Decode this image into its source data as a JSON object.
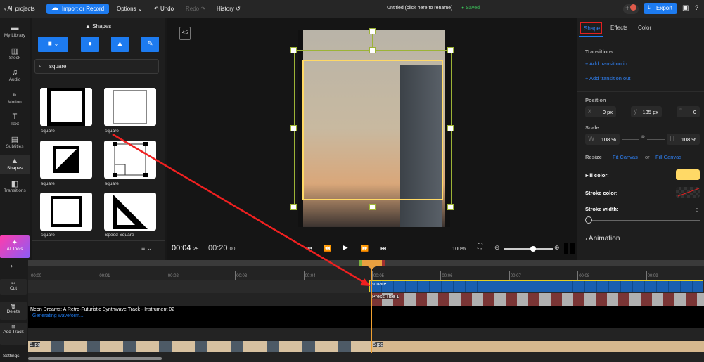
{
  "topbar": {
    "back": "All projects",
    "import": "Import or Record",
    "options": "Options",
    "undo": "Undo",
    "redo": "Redo",
    "history": "History",
    "title": "Untitled (click here to rename)",
    "saved": "Saved",
    "export": "Export"
  },
  "rail": [
    {
      "label": "My Library",
      "icon": "folder"
    },
    {
      "label": "Stock",
      "icon": "books"
    },
    {
      "label": "Audio",
      "icon": "music"
    },
    {
      "label": "Motion",
      "icon": "motion"
    },
    {
      "label": "Text",
      "icon": "T"
    },
    {
      "label": "Subtitles",
      "icon": "cc"
    },
    {
      "label": "Shapes",
      "icon": "shapes"
    },
    {
      "label": "Transitions",
      "icon": "transition"
    }
  ],
  "ai_tools": "AI Tools",
  "panel": {
    "title": "Shapes",
    "search_value": "square",
    "results": [
      {
        "label": "square"
      },
      {
        "label": "square"
      },
      {
        "label": "square"
      },
      {
        "label": "square"
      },
      {
        "label": "square"
      },
      {
        "label": "Speed Square"
      }
    ]
  },
  "preview": {
    "aspect": "4:5",
    "time_current": "00:04",
    "time_current_frames": "29",
    "time_total": "00:20",
    "time_total_frames": "00",
    "zoom": "100%",
    "zoom_slider": 0.6
  },
  "right": {
    "tabs": [
      "Shape",
      "Effects",
      "Color"
    ],
    "active_tab": "Shape",
    "transitions": "Transitions",
    "add_in": "+ Add transition in",
    "add_out": "+ Add transition out",
    "position": "Position",
    "x_label": "x",
    "x": "0 px",
    "y_label": "y",
    "y": "135 px",
    "rot_label": "°",
    "rotation": "0",
    "scale": "Scale",
    "w_label": "W",
    "w": "108 %",
    "h_label": "H",
    "h": "108 %",
    "resize": "Resize",
    "fit": "Fit Canvas",
    "or": "or",
    "fill": "Fill Canvas",
    "fill_color_label": "Fill color:",
    "fill_color": "#ffd966",
    "stroke_color_label": "Stroke color:",
    "stroke_width_label": "Stroke width:",
    "stroke_width": "0",
    "animation": "Animation"
  },
  "timeline": {
    "tools": [
      "Cut",
      "Delete",
      "Add Track",
      "Settings"
    ],
    "ticks": [
      "00:00",
      "00:01",
      "00:02",
      "00:03",
      "00:04",
      "00:05",
      "00:06",
      "00:07",
      "00:08",
      "00:09"
    ],
    "clips": {
      "shape": "square",
      "title": "Press Title 1",
      "audio": "Neon Dreams: A Retro-Futuristic Synthwave Track - Instrument 02",
      "audio_status": "Generating waveform...",
      "img1": "5.jpg",
      "img2": "6.jpg"
    }
  }
}
